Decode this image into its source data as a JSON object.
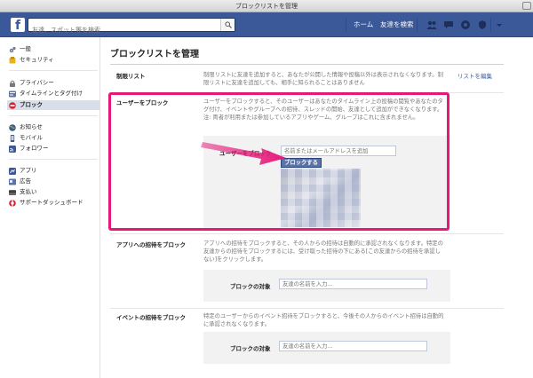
{
  "window": {
    "title": "ブロックリストを管理"
  },
  "topbar": {
    "logo": "f",
    "search_placeholder": "友達、スポット等を検索",
    "home": "ホーム",
    "find_friends": "友達を検索"
  },
  "sidebar": {
    "groups": [
      [
        {
          "label": "一般",
          "icon": "gear-icon",
          "color": "#6d7a8f"
        },
        {
          "label": "セキュリティ",
          "icon": "shield-icon",
          "color": "#e8b320"
        }
      ],
      [
        {
          "label": "プライバシー",
          "icon": "lock-icon",
          "color": "#7a7a7a"
        },
        {
          "label": "タイムラインとタグ付け",
          "icon": "timeline-icon",
          "color": "#5b74a8"
        },
        {
          "label": "ブロック",
          "icon": "block-icon",
          "color": "#d3232f",
          "active": true
        }
      ],
      [
        {
          "label": "お知らせ",
          "icon": "globe-icon",
          "color": "#3b5998"
        },
        {
          "label": "モバイル",
          "icon": "mobile-icon",
          "color": "#4a5a7a"
        },
        {
          "label": "フォロワー",
          "icon": "rss-icon",
          "color": "#3b5998"
        }
      ],
      [
        {
          "label": "アプリ",
          "icon": "apps-icon",
          "color": "#3b5998"
        },
        {
          "label": "広告",
          "icon": "ads-icon",
          "color": "#5b74a8"
        },
        {
          "label": "支払い",
          "icon": "payments-icon",
          "color": "#666666"
        },
        {
          "label": "サポートダッシュボード",
          "icon": "lifebuoy-icon",
          "color": "#d3232f"
        }
      ]
    ]
  },
  "main": {
    "title": "ブロックリストを管理",
    "restricted": {
      "label": "制限リスト",
      "text": "制限リストに友達を追加すると、あなたが公開した情報や投稿以外は表示されなくなります。制限リストに友達を追加しても、相手に知られることはありません",
      "link": "リストを編集"
    },
    "block_users": {
      "label": "ユーザーをブロック",
      "text": "ユーザーをブロックすると、そのユーザーはあなたのタイムライン上の投稿の閲覧やあなたのタグ付け、イベントやグループへの招待、スレッドの開始、友達として追加ができなくなります。注: 両者が利用または参加しているアプリやゲーム、グループはこれに含まれません。",
      "field_label": "ユーザーをブロック",
      "placeholder": "名前またはメールアドレスを追加",
      "button": "ブロックする"
    },
    "app_invites": {
      "label": "アプリへの招待をブロック",
      "text": "アプリへの招待をブロックすると、その人からの招待は自動的に承認されなくなります。特定の友達からの招待をブロックするには、受け取った招待の下にある[この友達からの招待を承認しない]をクリックします。",
      "field_label": "ブロックの対象",
      "placeholder": "友達の名前を入力..."
    },
    "event_invites": {
      "label": "イベントの招待をブロック",
      "text": "特定のユーザーからのイベント招待をブロックすると、今後その人からのイベント招待は自動的に承認されなくなります。",
      "field_label": "ブロックの対象",
      "placeholder": "友達の名前を入力..."
    }
  },
  "annotation": {
    "highlight_color": "#e6197a"
  }
}
